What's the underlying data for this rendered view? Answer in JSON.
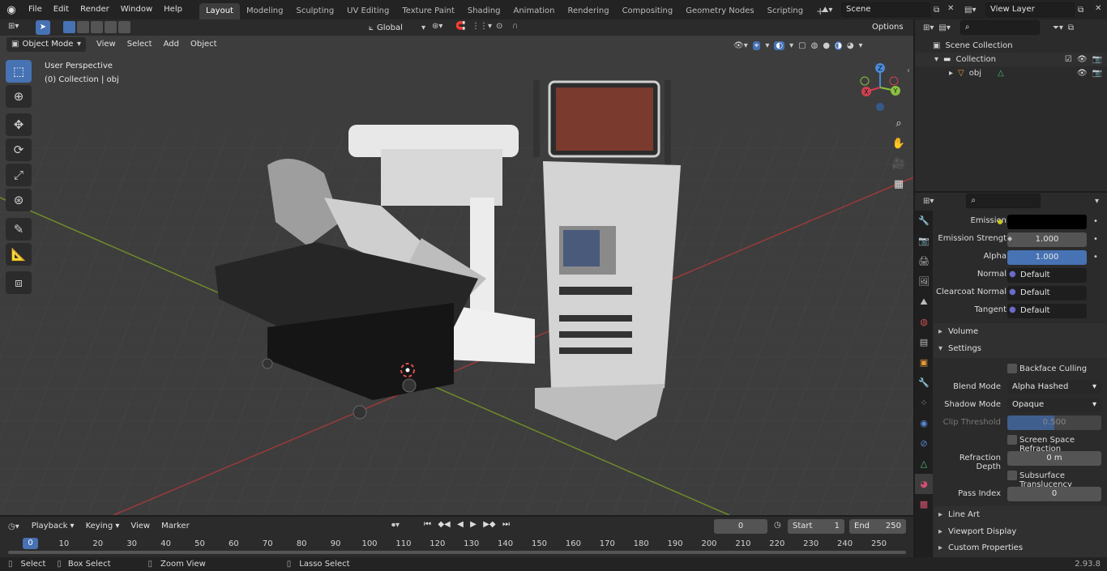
{
  "topbar": {
    "menus": [
      "File",
      "Edit",
      "Render",
      "Window",
      "Help"
    ],
    "workspaces": [
      "Layout",
      "Modeling",
      "Sculpting",
      "UV Editing",
      "Texture Paint",
      "Shading",
      "Animation",
      "Rendering",
      "Compositing",
      "Geometry Nodes",
      "Scripting"
    ],
    "active_workspace": "Layout",
    "add_tab": "+",
    "scene": "Scene",
    "view_layer": "View Layer"
  },
  "viewport": {
    "mode": "Object Mode",
    "menus": [
      "View",
      "Select",
      "Add",
      "Object"
    ],
    "orientation": "Global",
    "options": "Options",
    "overlay_title": "User Perspective",
    "overlay_sub": "(0) Collection | obj",
    "gizmo": {
      "x": "X",
      "y": "Y",
      "z": "Z"
    }
  },
  "outliner": {
    "scene_collection": "Scene Collection",
    "collection": "Collection",
    "object": "obj"
  },
  "properties": {
    "rows": [
      {
        "label": "Emission",
        "value": "",
        "dot": "#c8c820",
        "field": "color"
      },
      {
        "label": "Emission Strengt",
        "value": "1.000",
        "dot": "#a0a0a0",
        "field": "num"
      },
      {
        "label": "Alpha",
        "value": "1.000",
        "dot": "#a0a0a0",
        "field": "blue"
      },
      {
        "label": "Normal",
        "value": "Default",
        "dot": "#6a6ac8",
        "field": "dark"
      },
      {
        "label": "Clearcoat Normal",
        "value": "Default",
        "dot": "#6a6ac8",
        "field": "dark"
      },
      {
        "label": "Tangent",
        "value": "Default",
        "dot": "#6a6ac8",
        "field": "dark"
      }
    ],
    "volume": "Volume",
    "settings": "Settings",
    "backface": "Backface Culling",
    "blend_label": "Blend Mode",
    "blend_value": "Alpha Hashed",
    "shadow_label": "Shadow Mode",
    "shadow_value": "Opaque",
    "clip_label": "Clip Threshold",
    "clip_value": "0.500",
    "ssr": "Screen Space Refraction",
    "refr_label": "Refraction Depth",
    "refr_value": "0 m",
    "sst": "Subsurface Translucency",
    "pass_label": "Pass Index",
    "pass_value": "0",
    "line_art": "Line Art",
    "viewport_display": "Viewport Display",
    "custom_props": "Custom Properties"
  },
  "timeline": {
    "menus": [
      "Playback",
      "Keying",
      "View",
      "Marker"
    ],
    "current_frame": "0",
    "start_label": "Start",
    "start": "1",
    "end_label": "End",
    "end": "250",
    "ticks": [
      "0",
      "10",
      "20",
      "30",
      "40",
      "50",
      "60",
      "70",
      "80",
      "90",
      "100",
      "110",
      "120",
      "130",
      "140",
      "150",
      "160",
      "170",
      "180",
      "190",
      "200",
      "210",
      "220",
      "230",
      "240",
      "250"
    ]
  },
  "status": {
    "select": "Select",
    "box_select": "Box Select",
    "zoom_view": "Zoom View",
    "lasso": "Lasso Select",
    "version": "2.93.8"
  }
}
